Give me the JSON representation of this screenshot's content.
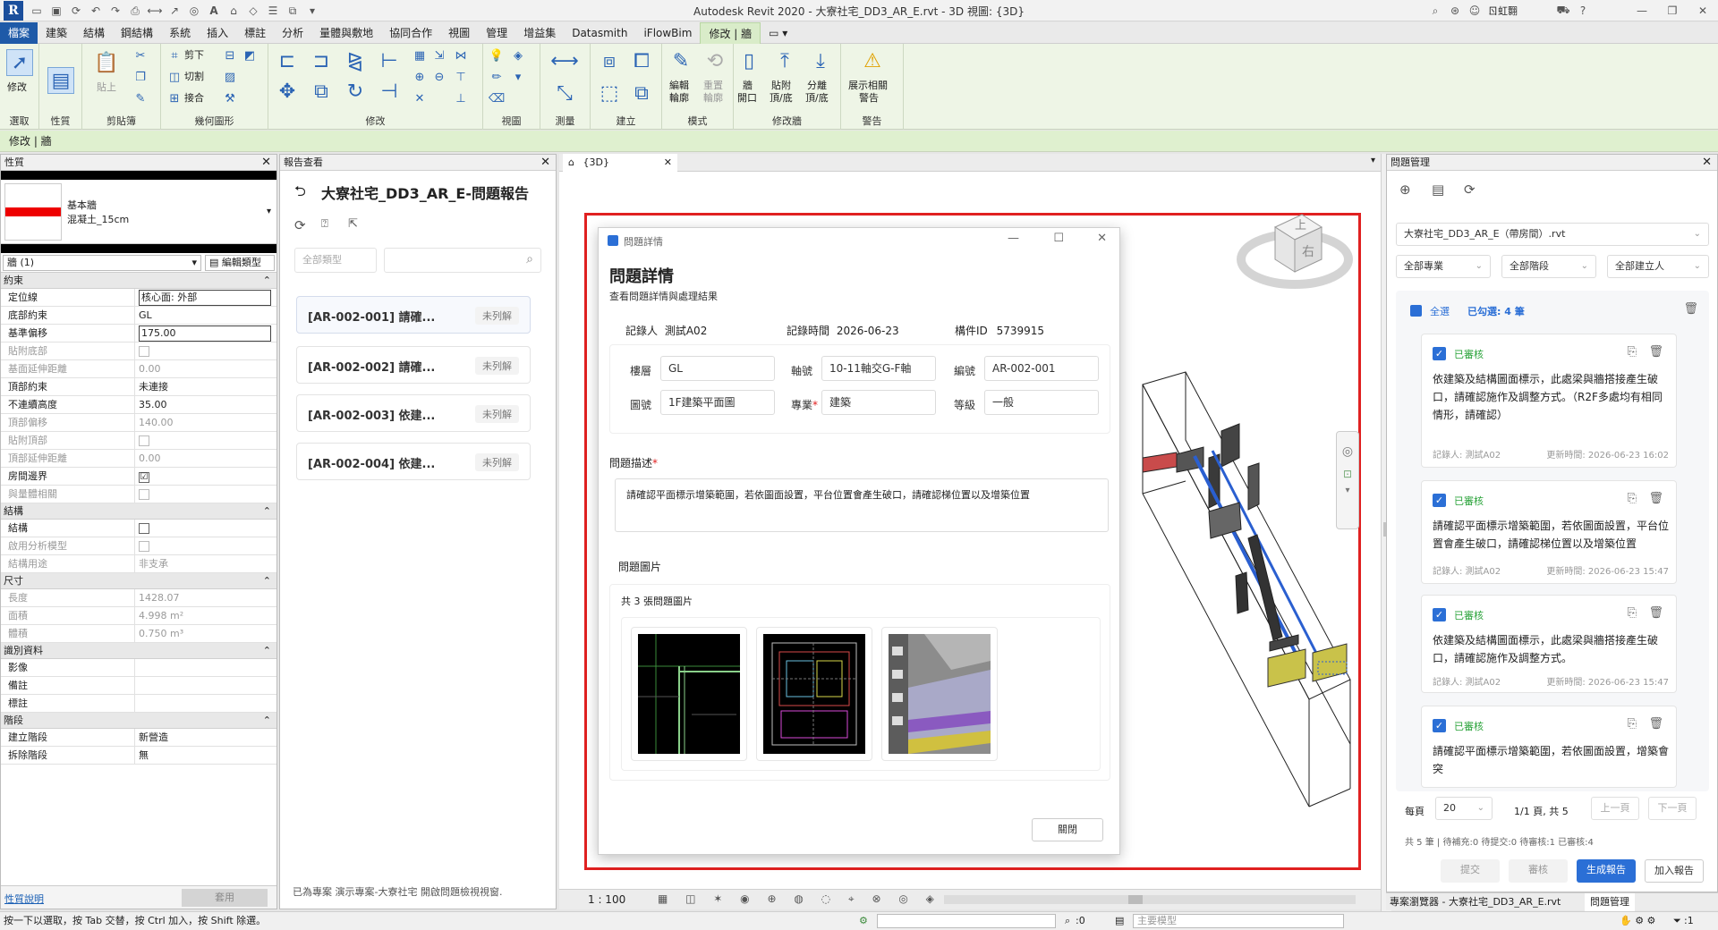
{
  "app": {
    "title": "Autodesk Revit 2020 - 大寮社宅_DD3_AR_E.rvt - 3D 視圖: {3D}",
    "logo": "R",
    "user": "ㄖ虹翾",
    "window_controls": [
      "—",
      "❐",
      "✕"
    ]
  },
  "tabs": [
    "檔案",
    "建築",
    "結構",
    "鋼結構",
    "系統",
    "插入",
    "標註",
    "分析",
    "量體與敷地",
    "協同合作",
    "視圖",
    "管理",
    "增益集",
    "Datasmith",
    "iFlowBim",
    "修改 | 牆"
  ],
  "ribbon": {
    "groups": {
      "select": "選取",
      "properties": "性質",
      "clipboard": "剪貼簿",
      "geometry": "幾何圖形",
      "modify": "修改",
      "view": "視圖",
      "measure": "測量",
      "create": "建立",
      "mode": "模式",
      "modify_wall": "修改牆",
      "warning": "警告"
    },
    "buttons": {
      "modify": "修改",
      "paste": "貼上",
      "cut_label": "剪下",
      "join_label": "接合",
      "cope_label": "切割",
      "edit_profile_1": "編輯",
      "edit_profile_2": "輪廓",
      "reset_profile_1": "重置",
      "reset_profile_2": "輪廓",
      "wall_opening_1": "牆",
      "wall_opening_2": "開口",
      "attach_1": "貼附",
      "attach_2": "頂/底",
      "detach_1": "分離",
      "detach_2": "頂/底",
      "warnings_1": "展示相關",
      "warnings_2": "警告"
    }
  },
  "context_bar": "修改 | 牆",
  "properties": {
    "header": "性質",
    "type_family": "基本牆",
    "type_name": "混凝土_15cm",
    "selector": "牆 (1)",
    "edit_type": "編輯類型",
    "sections": [
      {
        "title": "約束",
        "rows": [
          {
            "k": "定位線",
            "v": "核心面: 外部",
            "type": "box"
          },
          {
            "k": "底部約束",
            "v": "GL"
          },
          {
            "k": "基準偏移",
            "v": "175.00",
            "type": "box"
          },
          {
            "k": "貼附底部",
            "v": "",
            "type": "cbdis",
            "dis": true
          },
          {
            "k": "基面延伸距離",
            "v": "0.00",
            "dis": true
          },
          {
            "k": "頂部約束",
            "v": "未連接"
          },
          {
            "k": "不連續高度",
            "v": "35.00"
          },
          {
            "k": "頂部偏移",
            "v": "140.00",
            "dis": true
          },
          {
            "k": "貼附頂部",
            "v": "",
            "type": "cbdis",
            "dis": true
          },
          {
            "k": "頂部延伸距離",
            "v": "0.00",
            "dis": true
          },
          {
            "k": "房間邊界",
            "v": "☑",
            "type": "cbchk"
          },
          {
            "k": "與量體相關",
            "v": "",
            "type": "cbdis",
            "dis": true
          }
        ]
      },
      {
        "title": "結構",
        "rows": [
          {
            "k": "結構",
            "v": "",
            "type": "cb"
          },
          {
            "k": "啟用分析模型",
            "v": "",
            "type": "cbdis",
            "dis": true
          },
          {
            "k": "結構用途",
            "v": "非支承",
            "dis": true
          }
        ]
      },
      {
        "title": "尺寸",
        "rows": [
          {
            "k": "長度",
            "v": "1428.07",
            "dis": true
          },
          {
            "k": "面積",
            "v": "4.998 m²",
            "dis": true
          },
          {
            "k": "體積",
            "v": "0.750 m³",
            "dis": true
          }
        ]
      },
      {
        "title": "識別資料",
        "rows": [
          {
            "k": "影像",
            "v": ""
          },
          {
            "k": "備註",
            "v": ""
          },
          {
            "k": "標註",
            "v": ""
          }
        ]
      },
      {
        "title": "階段",
        "rows": [
          {
            "k": "建立階段",
            "v": "新營造"
          },
          {
            "k": "拆除階段",
            "v": "無"
          }
        ]
      }
    ],
    "help_link": "性質說明",
    "apply": "套用"
  },
  "report": {
    "header": "報告查看",
    "title": "大寮社宅_DD3_AR_E-問題報告",
    "filter_placeholder": "全部類型",
    "items": [
      {
        "id": "[AR-002-001] 請確...",
        "badge": "未列解"
      },
      {
        "id": "[AR-002-002] 請確...",
        "badge": "未列解"
      },
      {
        "id": "[AR-002-003] 依建...",
        "badge": "未列解"
      },
      {
        "id": "[AR-002-004] 依建...",
        "badge": "未列解"
      }
    ],
    "footer": "已為專案 演示專案-大寮社宅 開啟問題檢視視窗."
  },
  "view": {
    "tab": "{3D}",
    "scale": "1 : 100",
    "cube_top": "上",
    "cube_right": "右"
  },
  "dialog": {
    "window_title": "問題詳情",
    "heading": "問題詳情",
    "subheading": "查看問題詳情與處理結果",
    "recorder_label": "記錄人",
    "recorder": "測試A02",
    "time_label": "記錄時間",
    "time": "2026-06-23",
    "id_label": "構件ID",
    "element_id": "5739915",
    "fields": {
      "floor_label": "樓層",
      "floor": "GL",
      "grid_label": "軸號",
      "grid": "10-11軸交G-F軸",
      "code_label": "編號",
      "code": "AR-002-001",
      "drawing_label": "圖號",
      "drawing": "1F建築平面圖",
      "discipline_label": "專業",
      "discipline": "建築",
      "level_label": "等級",
      "level": "一般"
    },
    "desc_label": "問題描述",
    "description": "請確認平面標示增築範圍，若依圖面設置，平台位置會產生破口，請確認梯位置以及增築位置",
    "images_label": "問題圖片",
    "images_count": "共 3 張問題圖片",
    "close": "關閉"
  },
  "issues": {
    "header": "問題管理",
    "file": "大寮社宅_DD3_AR_E（帶房間）.rvt",
    "filters": [
      "全部專業",
      "全部階段",
      "全部建立人"
    ],
    "select_all": "全選",
    "selected": "已勾選: 4 筆",
    "cards": [
      {
        "status": "已審核",
        "text": "依建築及結構圖面標示，此處梁與牆搭接產生破口，請確認施作及調整方式。（R2F多處均有相同情形，請確認）",
        "recorder": "記錄人: 測試A02",
        "updated": "更新時間: 2026-06-23 16:02"
      },
      {
        "status": "已審核",
        "text": "請確認平面標示增築範圍，若依圖面設置，平台位置會產生破口，請確認梯位置以及增築位置",
        "recorder": "記錄人: 測試A02",
        "updated": "更新時間: 2026-06-23 15:47"
      },
      {
        "status": "已審核",
        "text": "依建築及結構圖面標示，此處梁與牆搭接產生破口，請確認施作及調整方式。",
        "recorder": "記錄人: 測試A02",
        "updated": "更新時間: 2026-06-23 15:47"
      },
      {
        "status": "已審核",
        "text": "請確認平面標示增築範圍，若依圖面設置，增築會突",
        "recorder": "",
        "updated": ""
      }
    ],
    "per_page_label": "每頁",
    "per_page": "20",
    "page_info": "1/1 頁, 共 5",
    "prev": "上一頁",
    "next": "下一頁",
    "summary": "共 5 筆 | 待補充:0 待提交:0 待審核:1 已審核:4",
    "buttons": [
      "提交",
      "審核",
      "生成報告",
      "加入報告"
    ]
  },
  "bottom_tabs": [
    "專案瀏覽器 - 大寮社宅_DD3_AR_E.rvt",
    "問題管理"
  ],
  "status": {
    "hint": "按一下以選取，按 Tab 交替，按 Ctrl 加入，按 Shift 除選。",
    "zero": ":0",
    "model": "主要模型",
    "filter": ":1"
  },
  "colors": {
    "accent": "#2b6fd6",
    "file_tab": "#1e5aa8",
    "ribbon": "#eef5e6",
    "highlight": "#e02020",
    "approved": "#2aa33a"
  }
}
